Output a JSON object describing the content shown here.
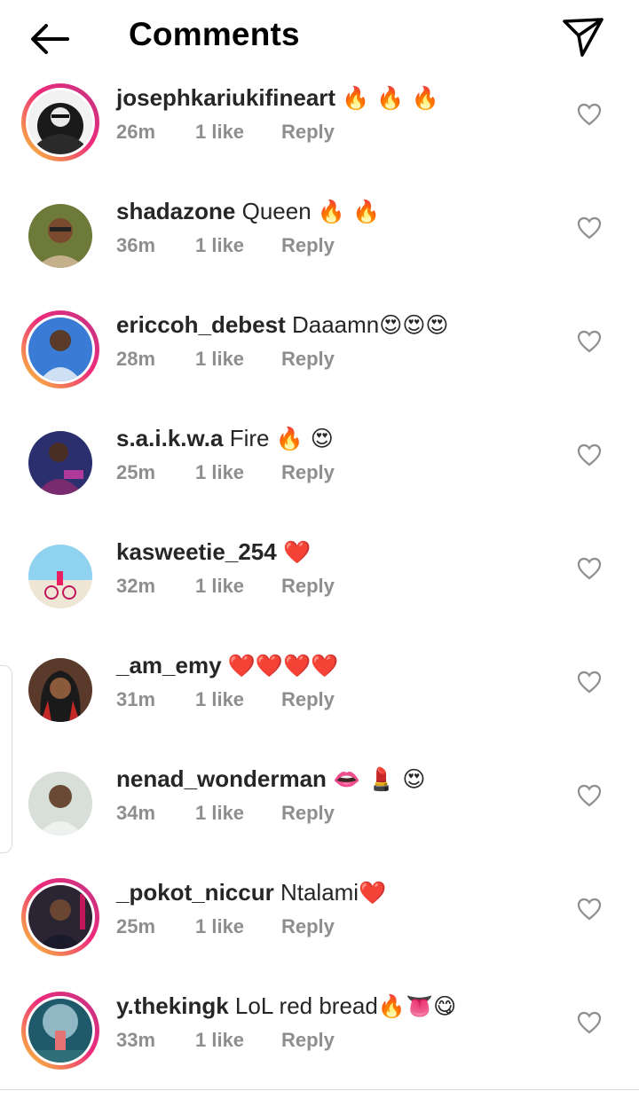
{
  "header": {
    "title": "Comments",
    "back_icon": "arrow-left-icon",
    "share_icon": "paper-plane-icon"
  },
  "comments": [
    {
      "username": "josephkariukifineart",
      "text": "",
      "emoji": "🔥 🔥 🔥",
      "time": "26m",
      "likes": "1 like",
      "reply": "Reply",
      "story_ring": true,
      "avatar": "bw-portrait"
    },
    {
      "username": "shadazone",
      "text": "Queen",
      "emoji": "🔥 🔥",
      "time": "36m",
      "likes": "1 like",
      "reply": "Reply",
      "story_ring": false,
      "avatar": "man-sunglasses"
    },
    {
      "username": "ericcoh_debest",
      "text": "Daaamn",
      "emoji": "😍😍😍",
      "time": "28m",
      "likes": "1 like",
      "reply": "Reply",
      "story_ring": true,
      "avatar": "man-blue-shirt"
    },
    {
      "username": "s.a.i.k.w.a",
      "text": "Fire",
      "emoji": "🔥 😍",
      "time": "25m",
      "likes": "1 like",
      "reply": "Reply",
      "story_ring": false,
      "avatar": "man-purple-suit"
    },
    {
      "username": "kasweetie_254",
      "text": "",
      "emoji": "❤️",
      "time": "32m",
      "likes": "1 like",
      "reply": "Reply",
      "story_ring": false,
      "avatar": "beach-bicycle"
    },
    {
      "username": "_am_emy",
      "text": "",
      "emoji": "❤️❤️❤️❤️",
      "time": "31m",
      "likes": "1 like",
      "reply": "Reply",
      "story_ring": false,
      "avatar": "woman-red-braids"
    },
    {
      "username": "nenad_wonderman",
      "text": "",
      "emoji": "👄 💄 😍",
      "time": "34m",
      "likes": "1 like",
      "reply": "Reply",
      "story_ring": false,
      "avatar": "man-light-shirt"
    },
    {
      "username": "_pokot_niccur",
      "text": "Ntalami",
      "emoji": "❤️",
      "time": "25m",
      "likes": "1 like",
      "reply": "Reply",
      "story_ring": true,
      "avatar": "man-dark-bg"
    },
    {
      "username": "y.thekingk",
      "text": "LoL red bread",
      "emoji": "🔥👅😋",
      "time": "33m",
      "likes": "1 like",
      "reply": "Reply",
      "story_ring": true,
      "avatar": "astronaut-moon"
    }
  ],
  "colors": {
    "meta_gray": "#8e8e8e",
    "text": "#262626",
    "ring_start": "#f9ce34",
    "ring_end": "#c13584"
  },
  "like_icon": "heart-outline-icon"
}
